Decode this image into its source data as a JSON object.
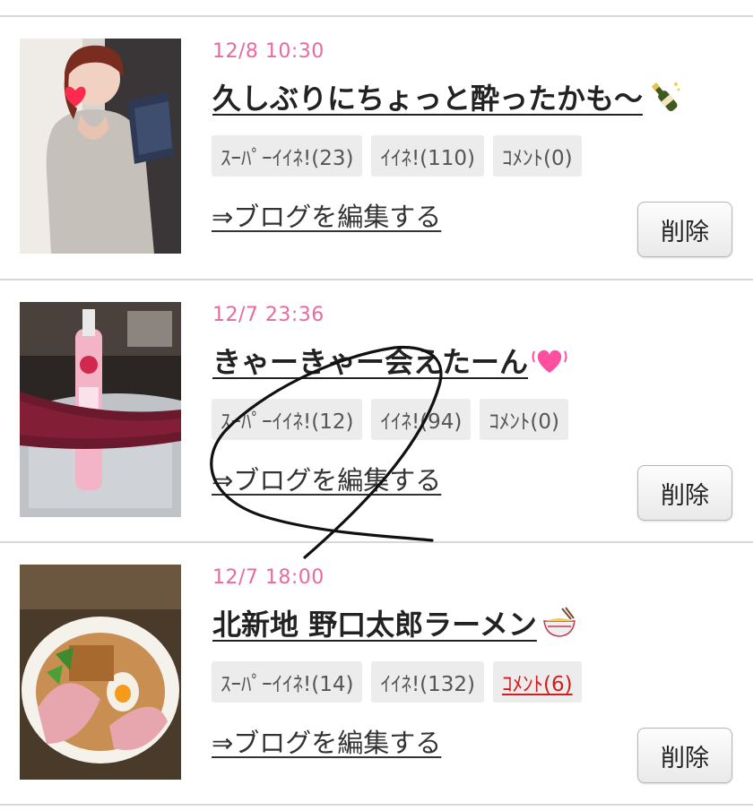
{
  "posts": [
    {
      "date": "12/8 10:30",
      "title": "久しぶりにちょっと酔ったかも〜",
      "emoji_icon": "champagne-bottle-icon",
      "super_like": "ｽｰﾊﾟｰｲｲﾈ!(23)",
      "like": "ｲｲﾈ!(110)",
      "comment": "ｺﾒﾝﾄ(0)",
      "edit_link": "⇒ブログを編集する",
      "delete_label": "削除"
    },
    {
      "date": "12/7 23:36",
      "title": "きゃーきゃー会えたーん",
      "emoji_icon": "vibrating-heart-icon",
      "super_like": "ｽｰﾊﾟｰｲｲﾈ!(12)",
      "like": "ｲｲﾈ!(94)",
      "comment": "ｺﾒﾝﾄ(0)",
      "edit_link": "⇒ブログを編集する",
      "delete_label": "削除"
    },
    {
      "date": "12/7 18:00",
      "title": "北新地 野口太郎ラーメン",
      "emoji_icon": "noodle-bowl-icon",
      "super_like": "ｽｰﾊﾟｰｲｲﾈ!(14)",
      "like": "ｲｲﾈ!(132)",
      "comment": "ｺﾒﾝﾄ(6)",
      "edit_link": "⇒ブログを編集する",
      "delete_label": "削除"
    }
  ],
  "colors": {
    "date": "#e86aa0",
    "comment_link": "#d01e1e",
    "tag_bg": "#ececec",
    "divider": "#d8d8d8",
    "annotation_stroke": "#111111"
  }
}
